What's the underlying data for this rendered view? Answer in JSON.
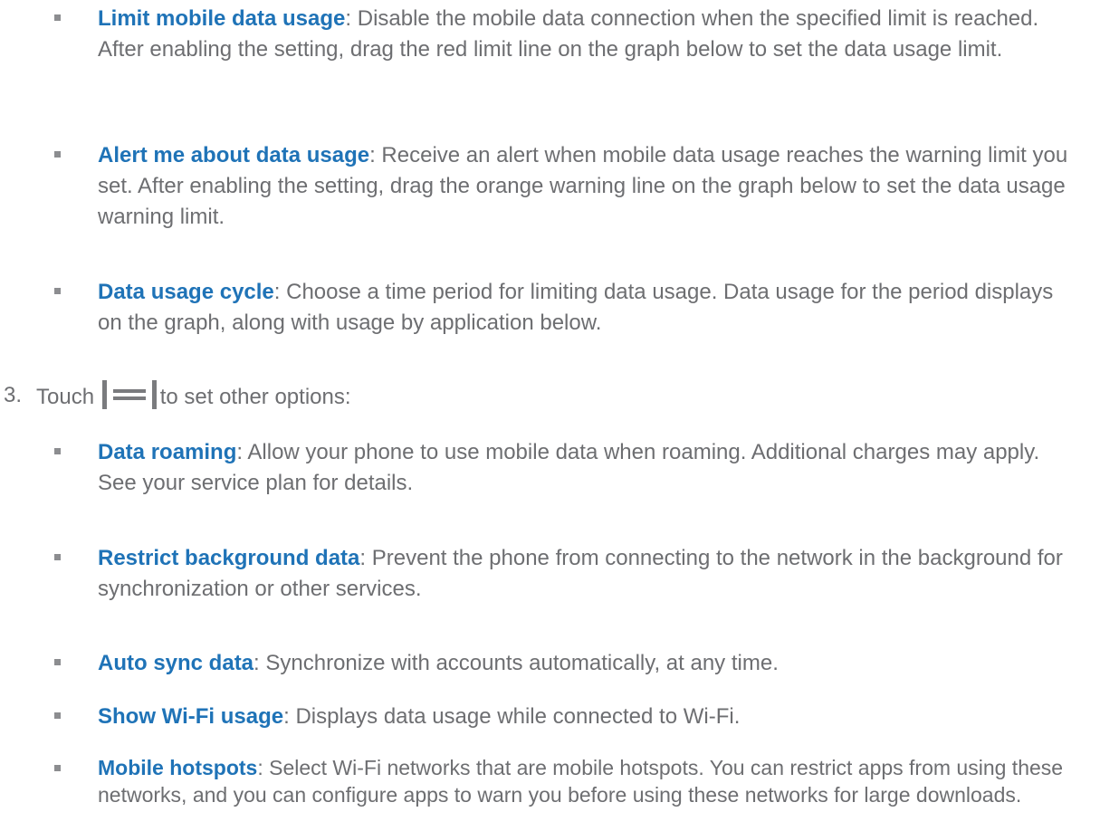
{
  "section_a": [
    {
      "term": "Limit mobile data usage",
      "sep": ":",
      "desc": " Disable the mobile data connection when the specified limit is reached. After enabling the setting, drag the red limit line on the graph below to set the data usage limit."
    },
    {
      "term": "Alert me about data usage",
      "sep": ":",
      "desc": " Receive an alert when mobile data usage reaches the warning limit you set. After enabling the setting, drag the orange warning line on the graph below to set the data usage warning limit."
    },
    {
      "term": "Data usage cycle",
      "sep": ":",
      "desc": " Choose a time period for limiting data usage. Data usage for the period displays on the graph, along with usage by application below."
    }
  ],
  "step3": {
    "number": "3.",
    "prefix": "Touch",
    "icon": "menu-icon",
    "suffix": "to set other options:"
  },
  "section_b": [
    {
      "term": "Data roaming",
      "sep": ":",
      "desc": " Allow your phone to use mobile data when roaming. Additional charges may apply. See your service plan for details."
    },
    {
      "term": "Restrict background data",
      "sep": ":",
      "desc": " Prevent the phone from connecting to the network in the background for synchronization or other services."
    },
    {
      "term": "Auto sync data",
      "sep": ":",
      "desc": " Synchronize with accounts automatically, at any time."
    },
    {
      "term": "Show Wi-Fi usage",
      "sep": ":",
      "desc": " Displays data usage while connected to Wi-Fi."
    },
    {
      "term": "Mobile hotspots",
      "sep": ":",
      "desc": " Select Wi-Fi networks that are mobile hotspots. You can restrict apps from using these networks, and you can configure apps to warn you before using these networks for large downloads."
    }
  ],
  "colors": {
    "term": "#1f73b7",
    "body_text": "#6d6e71",
    "bullet": "#8c8d90"
  }
}
